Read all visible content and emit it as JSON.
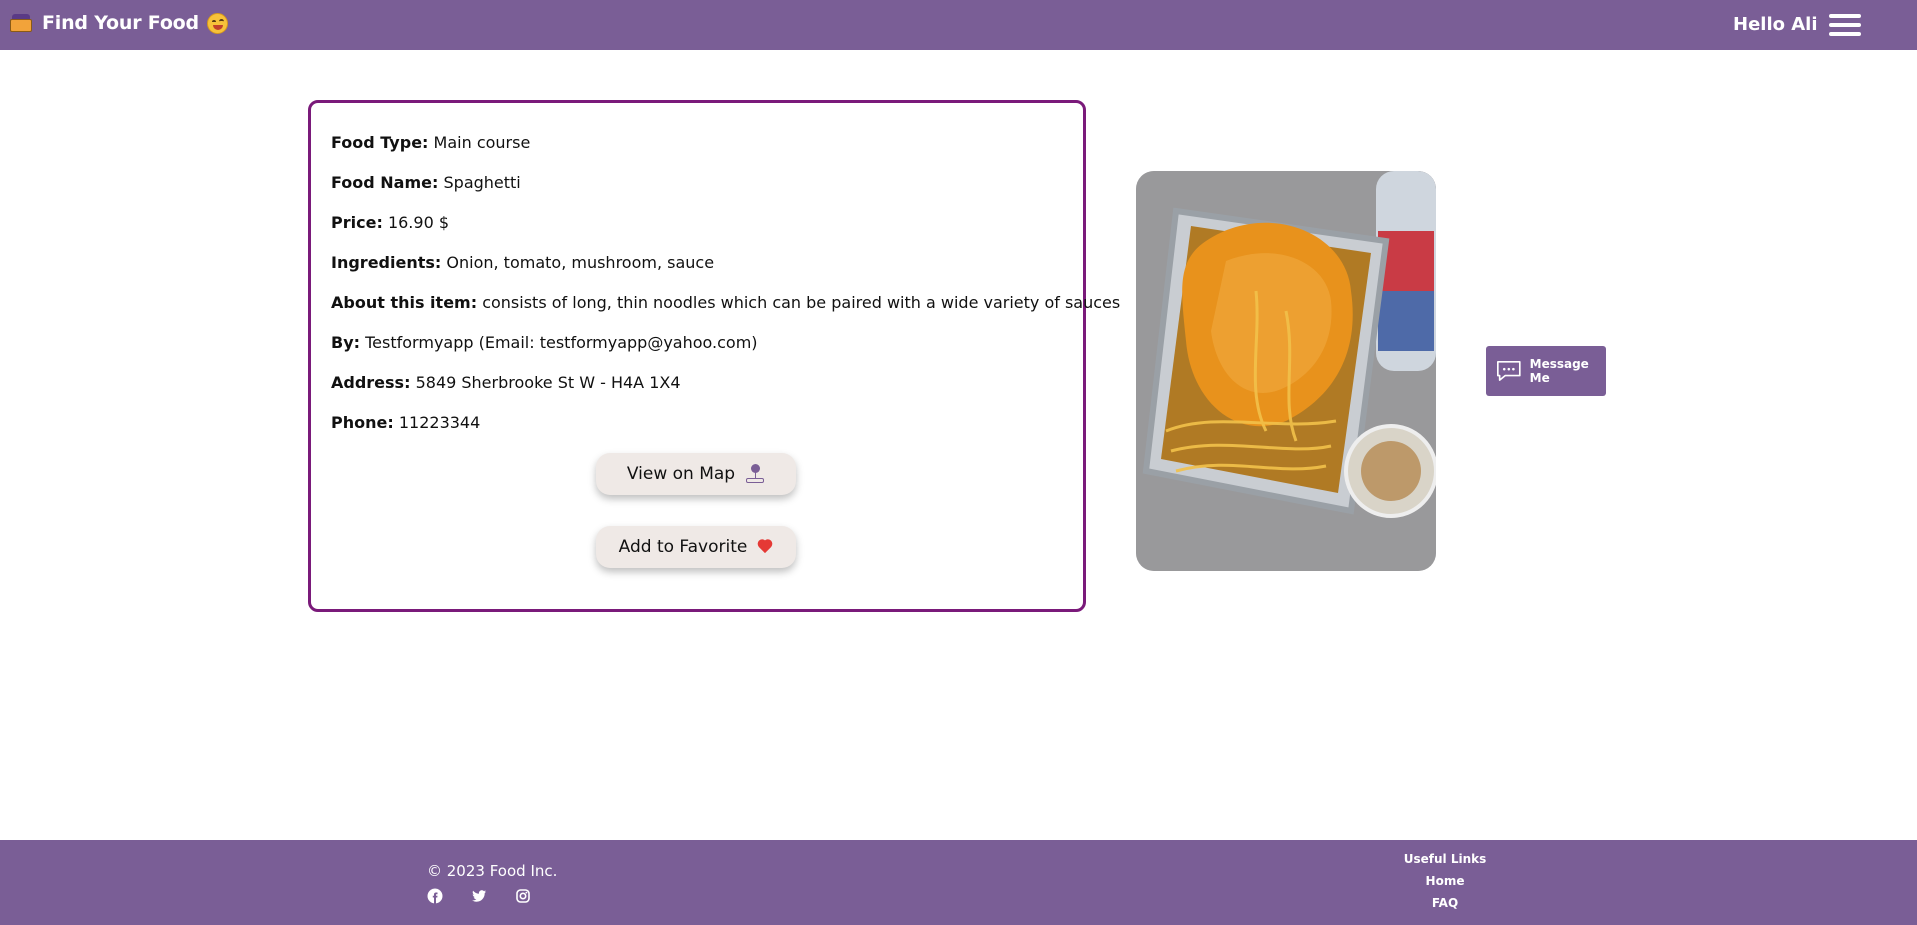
{
  "header": {
    "brand_title": "Find Your Food",
    "brand_icon": "lunchbox-icon",
    "brand_emoji": "yum-face-emoji",
    "greeting": "Hello Ali",
    "menu_icon": "hamburger-menu-icon",
    "background": "#7a5e96"
  },
  "food": {
    "food_type_label": "Food Type:",
    "food_type": "Main course",
    "food_name_label": "Food Name:",
    "food_name": "Spaghetti",
    "price_label": "Price:",
    "price": "16.90 $",
    "ingredients_label": "Ingredients:",
    "ingredients": "Onion, tomato, mushroom, sauce",
    "about_label": "About this item:",
    "about": "consists of long, thin noodles which can be paired with a wide variety of sauces",
    "by_label": "By:",
    "by": "Testformyapp (Email: testformyapp@yahoo.com)",
    "address_label": "Address:",
    "address": "5849 Sherbrooke St W - H4A 1X4",
    "phone_label": "Phone:",
    "phone": "11223344",
    "card_border_color": "#7a1a7a"
  },
  "buttons": {
    "view_on_map": "View on Map",
    "add_to_favorite": "Add to Favorite",
    "map_icon": "map-pin-icon",
    "favorite_icon": "heart-icon"
  },
  "message": {
    "label": "Message Me",
    "icon": "chat-bubble-icon"
  },
  "footer": {
    "copyright": "© 2023 Food Inc.",
    "social_icons": [
      "facebook-icon",
      "twitter-icon",
      "instagram-icon"
    ],
    "useful_links_title": "Useful Links",
    "links": [
      "Home",
      "FAQ"
    ]
  }
}
